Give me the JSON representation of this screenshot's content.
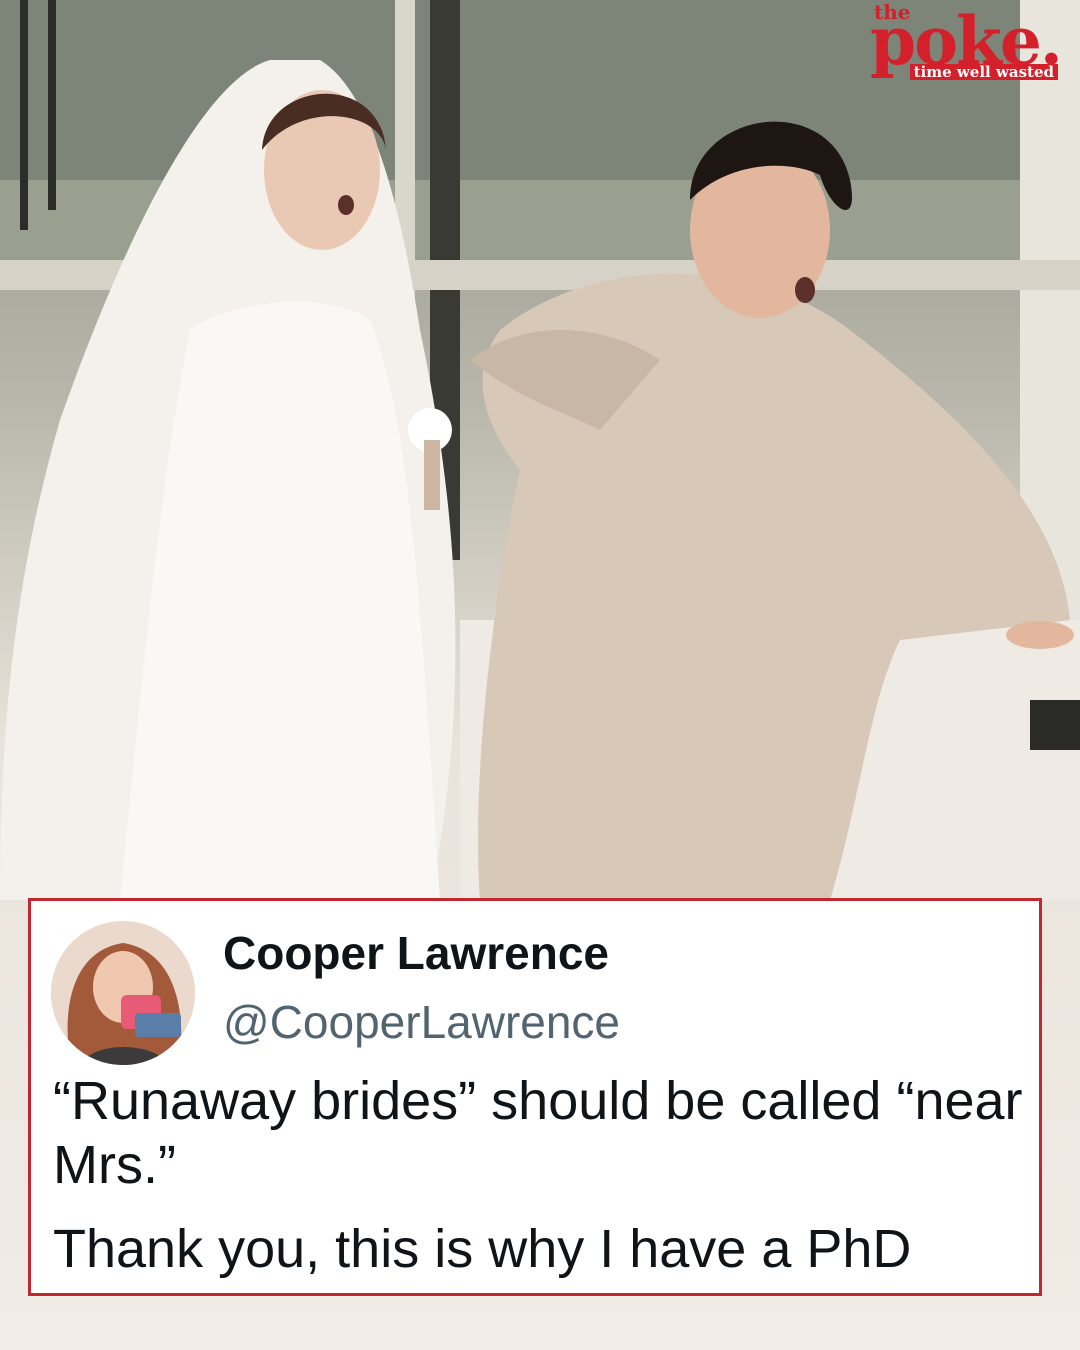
{
  "brand": {
    "logo_the": "the",
    "logo_word": "poke.",
    "tagline": "time well wasted",
    "color": "#d4202b"
  },
  "tweet": {
    "name": "Cooper Lawrence",
    "handle": "@CooperLawrence",
    "text_line_1": "“Runaway brides” should be called “near Mrs.”",
    "text_line_2": "Thank you, this is why I have a PhD",
    "border_color": "#c3262f"
  }
}
